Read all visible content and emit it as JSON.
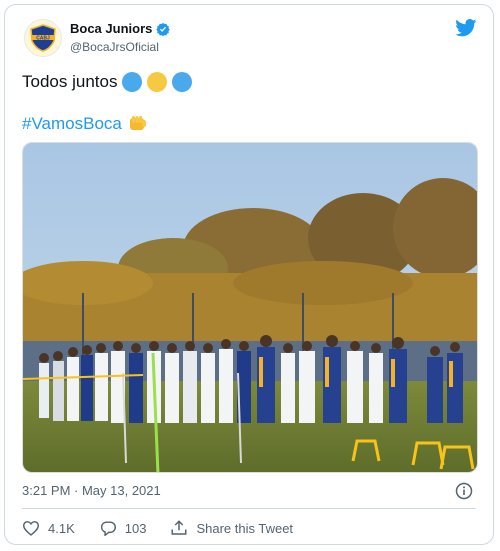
{
  "author": {
    "name": "Boca Juniors",
    "handle": "@BocaJrsOficial",
    "avatar_text": "CABJ",
    "verified": true
  },
  "tweet": {
    "text": "Todos juntos",
    "circle_emoji_colors": [
      "#4aa8ec",
      "#f7c841",
      "#4aa8ec"
    ],
    "hashtag": "#VamosBoca",
    "hashtag_emoji": "fist-icon"
  },
  "meta": {
    "timestamp": "3:21 PM · May 13, 2021"
  },
  "actions": {
    "likes": "4.1K",
    "replies": "103",
    "share_label": "Share this Tweet"
  },
  "colors": {
    "accent": "#1d9bf0",
    "secondary_text": "#536471"
  }
}
